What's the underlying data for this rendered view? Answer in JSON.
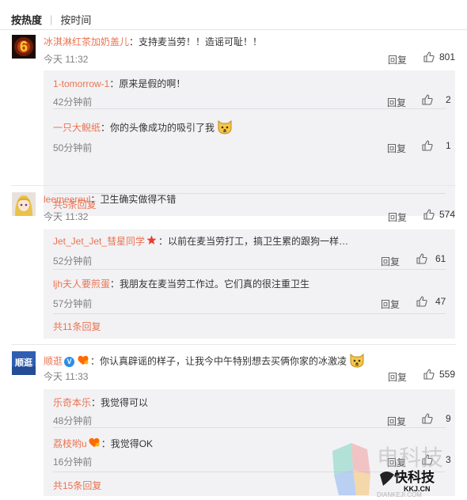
{
  "tabs": {
    "hot": "按热度",
    "time": "按时间"
  },
  "comments": [
    {
      "user": "冰淇淋红茶加奶盖儿",
      "text": "支持麦当劳！！造谣可耻！！",
      "time": "今天 11:32",
      "reply_label": "回复",
      "likes": "801",
      "replies": [
        {
          "user": "1-tomorrow-1",
          "text": "原来是假的啊！",
          "time": "42分钟前",
          "reply_label": "回复",
          "likes": "2"
        },
        {
          "user": "一只大鲵纸",
          "text": "你的头像成功的吸引了我",
          "emoji": "dog-face-emoji",
          "time": "50分钟前",
          "reply_label": "回复",
          "likes": "1"
        }
      ],
      "more": "共5条回复"
    },
    {
      "user": "leemeereul",
      "text": "卫生确实做得不错",
      "time": "今天 11:32",
      "reply_label": "回复",
      "likes": "574",
      "replies": [
        {
          "user": "Jet_Jet_Jet_彗星同学",
          "badge": "star-badge-icon",
          "text": "以前在麦当劳打工，搞卫生累的跟狗一样…",
          "time": "52分钟前",
          "reply_label": "回复",
          "likes": "61"
        },
        {
          "user": "ljh夫人要煎蛋",
          "text": "我朋友在麦当劳工作过。它们真的很注重卫生",
          "time": "57分钟前",
          "reply_label": "回复",
          "likes": "47"
        }
      ],
      "more": "共11条回复"
    },
    {
      "user": "顺逛",
      "badges": [
        "verified-v-icon",
        "heart-badge-icon"
      ],
      "text": "你认真辟谣的样子，让我今中午特别想去买俩你家的冰激凌",
      "emoji": "dog-face-emoji",
      "time": "今天 11:33",
      "reply_label": "回复",
      "likes": "559",
      "avatar_text": "顺逛",
      "replies": [
        {
          "user": "乐奇本乐",
          "text": "我觉得可以",
          "time": "48分钟前",
          "reply_label": "回复",
          "likes": "9"
        },
        {
          "user": "荔枝哟u",
          "badge": "heart-badge-icon",
          "text": "我觉得OK",
          "time": "16分钟前",
          "reply_label": "回复",
          "likes": "3"
        }
      ],
      "more": "共15条回复"
    }
  ],
  "avatar1_text": "6",
  "watermark": {
    "line1": "电科技",
    "line2": "快科技",
    "line3": "KKJ.CN",
    "line4": "DIANKEJI.COM"
  },
  "colors": {
    "link": "#eb7350",
    "reply_bg": "#f2f2f5",
    "verified": "#2e8ee6",
    "heart": "#ff6a00"
  }
}
